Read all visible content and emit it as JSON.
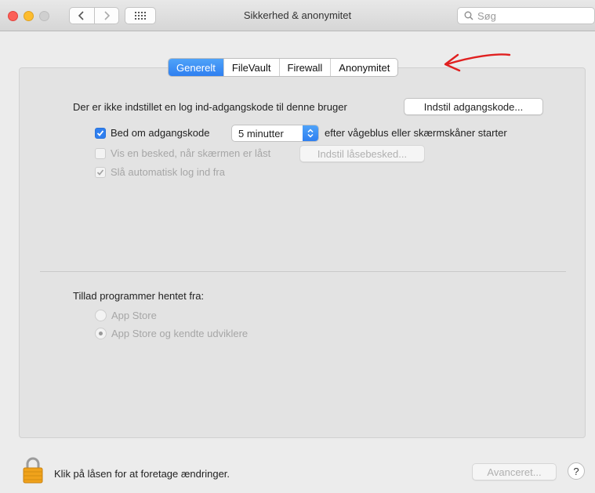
{
  "window": {
    "title": "Sikkerhed & anonymitet",
    "search_placeholder": "Søg"
  },
  "tabs": [
    {
      "label": "Generelt",
      "active": true
    },
    {
      "label": "FileVault",
      "active": false
    },
    {
      "label": "Firewall",
      "active": false
    },
    {
      "label": "Anonymitet",
      "active": false
    }
  ],
  "general": {
    "no_password_text": "Der er ikke indstillet en log ind-adgangskode til denne bruger",
    "set_password_button": "Indstil adgangskode...",
    "require_password": {
      "label": "Bed om adgangskode",
      "checked": true
    },
    "delay_value": "5 minutter",
    "after_text": "efter vågeblus eller skærmskåner starter",
    "show_message": {
      "label": "Vis en besked, når skærmen er låst",
      "checked": false,
      "enabled": false
    },
    "set_lock_message_button": "Indstil låsebesked...",
    "disable_auto_login": {
      "label": "Slå automatisk log ind fra",
      "checked": true,
      "enabled": false
    }
  },
  "allow_apps": {
    "heading": "Tillad programmer hentet fra:",
    "options": [
      {
        "label": "App Store",
        "selected": false
      },
      {
        "label": "App Store og kendte udviklere",
        "selected": true
      }
    ]
  },
  "footer": {
    "lock_text": "Klik på låsen for at foretage ændringer.",
    "advanced_button": "Avanceret...",
    "help_label": "?"
  },
  "colors": {
    "accent": "#2f7ff0",
    "annotation_arrow": "#e02020"
  }
}
